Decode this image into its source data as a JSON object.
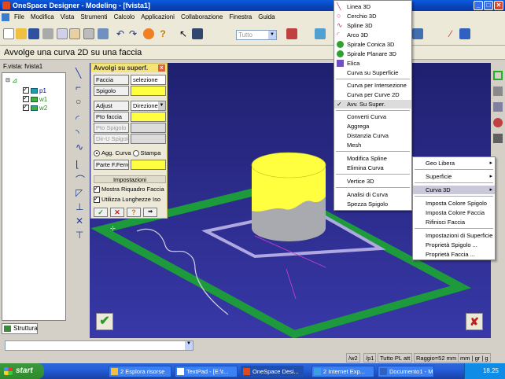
{
  "window": {
    "title": "OneSpace Designer - Modeling - [fvista1]",
    "controls": [
      "_",
      "□",
      "✕"
    ]
  },
  "menubar": {
    "items": [
      "File",
      "Modifica",
      "Vista",
      "Strumenti",
      "Calcolo",
      "Applicazioni",
      "Collaborazione",
      "Finestra",
      "Guida"
    ]
  },
  "toolbar": {
    "combo_value": "Tutto"
  },
  "prompt": "Avvolge una curva 2D su una faccia",
  "left_panel": {
    "header": "F.vista: fvista1",
    "tree": [
      {
        "label": "p1"
      },
      {
        "label": "w1"
      },
      {
        "label": "w2"
      }
    ],
    "tab_label": "Struttura"
  },
  "dialog": {
    "title": "Avvolgi su superf.",
    "close": "x",
    "faccia_label": "Faccia",
    "faccia_value": "selezione",
    "spigolo_label": "Spigolo",
    "adjust_label": "Adjust",
    "direzione_label": "Direzione",
    "pto_faccia_label": "Pto faccia",
    "pto_spigolo_label": "Pto Spigolo",
    "dir_u_spigolo_label": "Dir-U Spigolo",
    "radio_agg_curva": "Agg. Curva",
    "radio_stampa": "Stampa",
    "parte_ferro_label": "Parte F.Ferro",
    "impostazioni_label": "Impostazioni",
    "mostra_riquadro": "Mostra Riquadro Faccia",
    "utilizza_lunghezze": "Utilizza Lunghezze Iso",
    "actions": {
      "ok": "✓",
      "cancel": "✕",
      "help": "?",
      "more": "⇒"
    }
  },
  "curve_menu": {
    "items": [
      {
        "label": "Linea 3D",
        "icon": "line-3d-icon"
      },
      {
        "label": "Cerchio 3D",
        "icon": "circle-3d-icon"
      },
      {
        "label": "Spline 3D",
        "icon": "spline-3d-icon"
      },
      {
        "label": "Arco 3D",
        "icon": "arc-3d-icon"
      },
      {
        "label": "Spirale Conica 3D",
        "icon": "conical-spiral-icon"
      },
      {
        "label": "Spirale Planare 3D",
        "icon": "planar-spiral-icon"
      },
      {
        "label": "Elica",
        "icon": "helix-icon"
      },
      {
        "label": "Curva su Superficie",
        "icon": ""
      },
      {
        "label": "Curva per Intersezione",
        "icon": ""
      },
      {
        "label": "Curva per Curve 2D",
        "icon": ""
      },
      {
        "label": "Avv. Su Super.",
        "icon": "check-icon"
      },
      {
        "label": "Converti Curva",
        "icon": ""
      },
      {
        "label": "Aggrega",
        "icon": ""
      },
      {
        "label": "Distanzia Curva",
        "icon": ""
      },
      {
        "label": "Mesh",
        "icon": ""
      },
      {
        "label": "Modifica Spline",
        "icon": ""
      },
      {
        "label": "Elimina Curva",
        "icon": ""
      },
      {
        "label": "Vertice 3D",
        "icon": ""
      },
      {
        "label": "Analisi di Curva",
        "icon": ""
      },
      {
        "label": "Spezza Spigolo",
        "icon": ""
      }
    ]
  },
  "geo_menu": {
    "items": [
      {
        "label": "Geo Libera",
        "submenu": true
      },
      {
        "label": "Superficie",
        "submenu": true
      },
      {
        "label": "Curva 3D",
        "submenu": true
      },
      {
        "label": "Imposta Colore Spigolo",
        "submenu": false
      },
      {
        "label": "Imposta Colore Faccia",
        "submenu": false
      },
      {
        "label": "Rifinisci Faccia",
        "submenu": false
      },
      {
        "label": "Impostazioni di Superficie",
        "submenu": false
      },
      {
        "label": "Proprietà Spigolo ...",
        "submenu": false
      },
      {
        "label": "Proprietà Faccia ...",
        "submenu": false
      }
    ]
  },
  "viewport": {
    "ok_label": "✔",
    "cancel_label": "✘"
  },
  "statusbar": {
    "cells": [
      "/w2",
      "/p1",
      "Tutto PL att",
      "Raggio=52 mm",
      "mm | gr | g"
    ]
  },
  "taskbar": {
    "start": "start",
    "tasks": [
      "2 Esplora risorse",
      "TextPad - [E:\\t...",
      "OneSpace Desi...",
      "2 Internet Exp...",
      "Documento1 - M..."
    ],
    "clock": "18.25"
  },
  "colors": {
    "titlebar": "#0a5be0",
    "viewport_bg": "#2a2a8a",
    "highlight": "#316ac5",
    "yellow_field": "#ffff40",
    "green_frame": "#1c9a3c"
  }
}
